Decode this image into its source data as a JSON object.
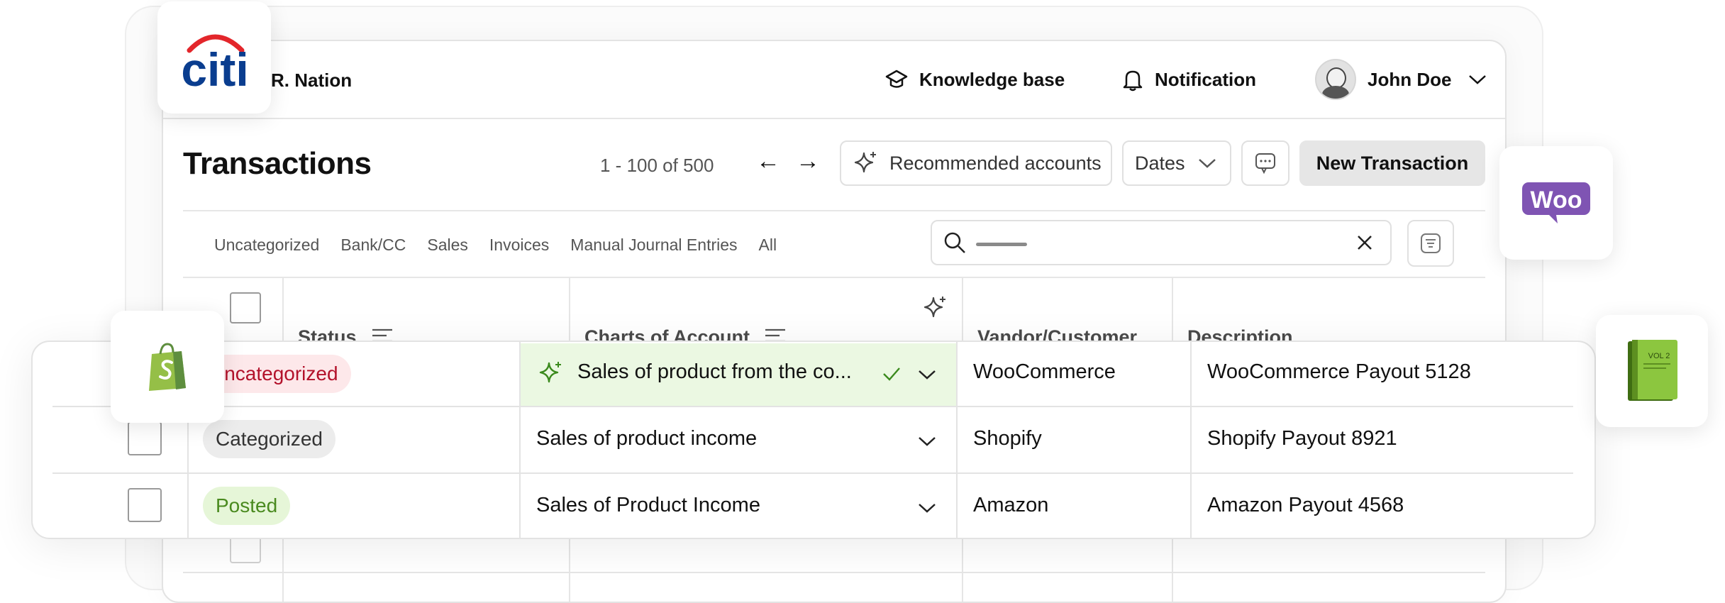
{
  "header": {
    "company_name": "R. Nation",
    "knowledge_base": "Knowledge base",
    "notification": "Notification",
    "user_name": "John Doe"
  },
  "toolbar": {
    "title": "Transactions",
    "pagination": "1 - 100 of 500",
    "prev_arrow": "←",
    "next_arrow": "→",
    "recommended_label": "Recommended accounts",
    "dates_label": "Dates",
    "new_transaction_label": "New Transaction"
  },
  "filters": {
    "tabs": [
      "Uncategorized",
      "Bank/CC",
      "Sales",
      "Invoices",
      "Manual Journal Entries",
      "All"
    ]
  },
  "search": {
    "placeholder": ""
  },
  "table": {
    "columns": [
      "Status",
      "Charts of Account",
      "Vandor/Customer",
      "Description"
    ],
    "rows": [
      {
        "status": "Uncategorized",
        "account": "Sales of product from the co...",
        "vendor": "WooCommerce",
        "description": "WooCommerce Payout 5128"
      },
      {
        "status": "Categorized",
        "account": "Sales of product income",
        "vendor": "Shopify",
        "description": "Shopify Payout 8921"
      },
      {
        "status": "Posted",
        "account": "Sales of Product Income",
        "vendor": "Amazon",
        "description": "Amazon Payout 4568"
      }
    ]
  },
  "logos": {
    "citi": "citi",
    "woo": "Woo",
    "book": "VOL 2"
  },
  "colors": {
    "uncategorized_bg": "#fde8ea",
    "uncategorized_text": "#b3122b",
    "categorized_bg": "#ececec",
    "posted_bg": "#e6f6d8",
    "posted_text": "#4a8a1f",
    "highlight_cell": "#ebf8e2",
    "woo_purple": "#7f54b3",
    "shopify_green": "#95bf47",
    "citi_blue": "#0a3d8f",
    "citi_red": "#e3262b"
  }
}
